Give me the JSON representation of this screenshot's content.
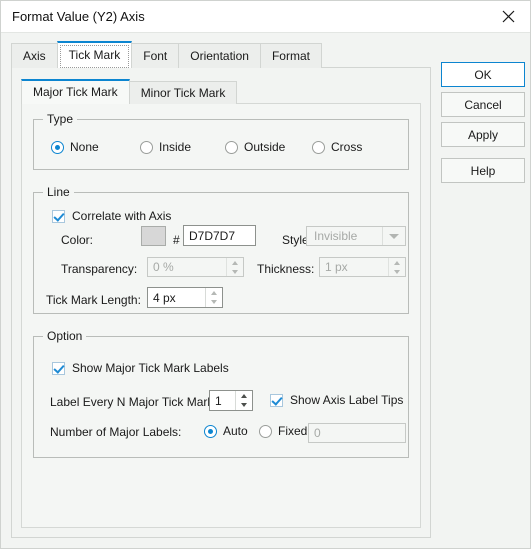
{
  "window": {
    "title": "Format Value (Y2) Axis",
    "close_icon": "close-icon"
  },
  "tabs": [
    {
      "label": "Axis",
      "selected": false
    },
    {
      "label": "Tick Mark",
      "selected": true
    },
    {
      "label": "Font",
      "selected": false
    },
    {
      "label": "Orientation",
      "selected": false
    },
    {
      "label": "Format",
      "selected": false
    }
  ],
  "subtabs": [
    {
      "label": "Major Tick Mark",
      "selected": true
    },
    {
      "label": "Minor Tick Mark",
      "selected": false
    }
  ],
  "groups": {
    "type": {
      "legend": "Type",
      "options": [
        {
          "label": "None",
          "checked": true
        },
        {
          "label": "Inside",
          "checked": false
        },
        {
          "label": "Outside",
          "checked": false
        },
        {
          "label": "Cross",
          "checked": false
        }
      ]
    },
    "line": {
      "legend": "Line",
      "correlate_label": "Correlate with Axis",
      "correlate_checked": true,
      "color_label": "Color:",
      "color_swatch": "#D7D7D7",
      "hash": "#",
      "color_value": "D7D7D7",
      "style_label": "Style:",
      "style_value": "Invisible",
      "transparency_label": "Transparency:",
      "transparency_value": "0 %",
      "thickness_label": "Thickness:",
      "thickness_value": "1 px",
      "tick_length_label": "Tick Mark Length:",
      "tick_length_value": "4 px"
    },
    "option": {
      "legend": "Option",
      "show_labels_text": "Show Major Tick Mark Labels",
      "show_labels_checked": true,
      "label_every_n_label": "Label Every N Major Tick Marks:",
      "label_every_n_value": "1",
      "show_tips_text": "Show Axis Label Tips",
      "show_tips_checked": true,
      "number_labels_label": "Number of Major Labels:",
      "auto_label": "Auto",
      "auto_checked": true,
      "fixed_label": "Fixed",
      "fixed_checked": false,
      "fixed_value": "0"
    }
  },
  "buttons": {
    "ok": "OK",
    "cancel": "Cancel",
    "apply": "Apply",
    "help": "Help"
  },
  "colors": {
    "accent": "#0c85d0",
    "dialog_bg": "#f2f4f2",
    "panel_bg": "#f4f6f4"
  }
}
